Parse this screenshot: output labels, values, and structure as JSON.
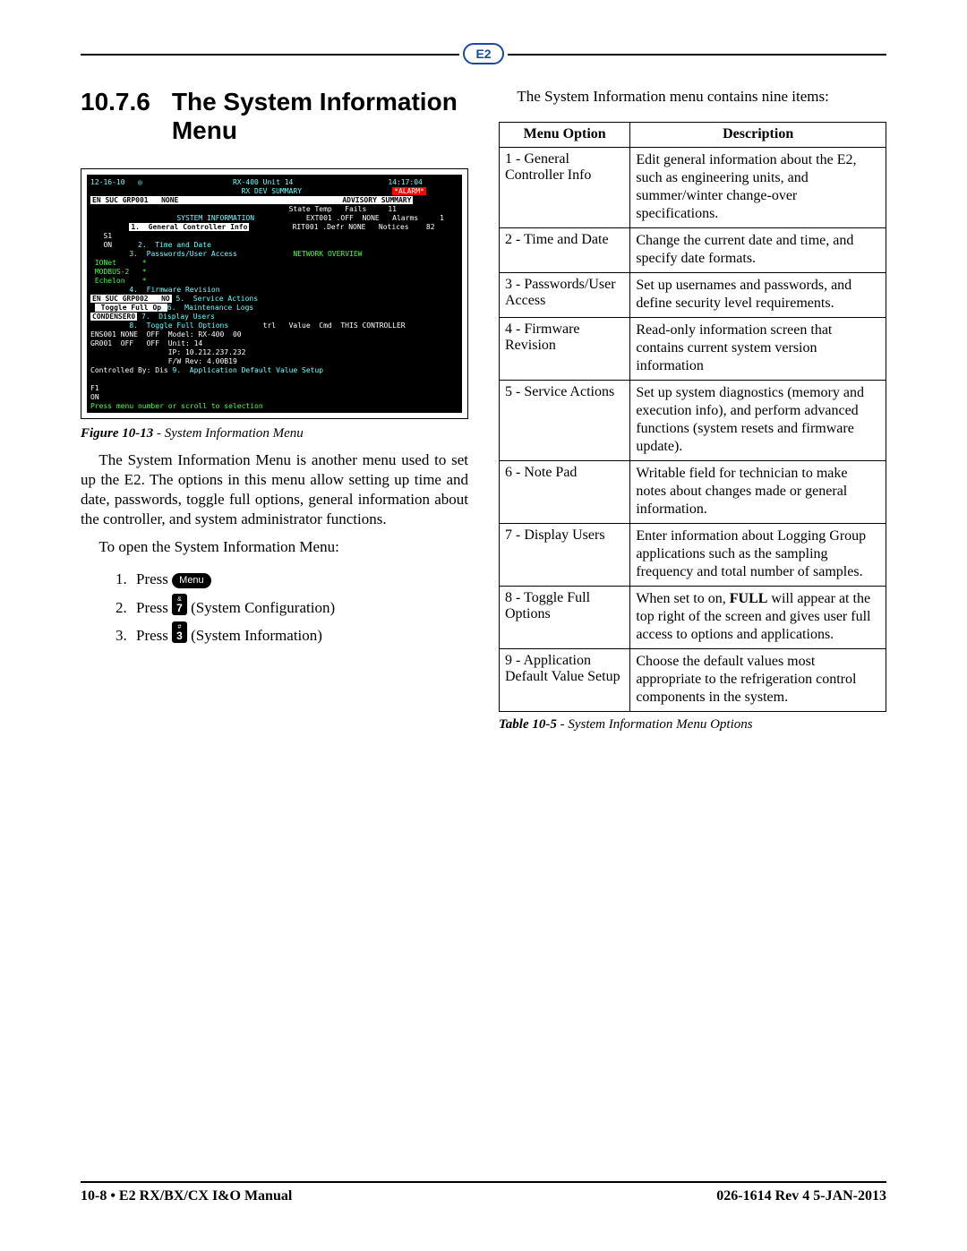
{
  "header_logo": "E2",
  "section": {
    "number": "10.7.6",
    "title": "The System Information Menu"
  },
  "figure": {
    "label": "Figure 10-13",
    "caption": "System Information Menu",
    "term": {
      "topline": "12-16-10   ◎                     RX-400 Unit 14                      14:17:04",
      "topline2": "                                   RX DEV SUMMARY                     ",
      "alarm": "*ALARM*",
      "row_head": "EN SUC GRP001   NONE                                      ADVISORY SUMMARY",
      "state": "State Temp   Fails     11",
      "menu_title": "          SYSTEM INFORMATION          ",
      "ext": "EXT001 .OFF  NONE   Alarms     1",
      "rit": "RIT001 .Defr NONE   Notices    82",
      "items": [
        "1.  General Controller Info",
        "2.  Time and Date",
        "3.  Passwords/User Access",
        "4.  Firmware Revision",
        "5.  Service Actions",
        "6.  Maintenance Logs",
        "7.  Display Users",
        "8.  Toggle Full Options",
        "9.  Application Default Value Setup"
      ],
      "s1": "   S1\n   ON",
      "nw": "NETWORK OVERVIEW\n IONet      *\n MODBUS-2   *\n Echelon    *",
      "ensuc2": "EN SUC GRP002   NO",
      "toggle": " Toggle Full Op ",
      "cond": "CONDENSER0",
      "ctrlby": "Controlled By: Dis",
      "f1": "F1\nON",
      "trl": "trl   Value  Cmd  THIS CONTROLLER\nENS001 NONE  OFF  Model: RX-400  00\nGR001  OFF   OFF  Unit: 14\n                  IP: 10.212.237.232\n                  F/W Rev: 4.00B19",
      "hint": "Press menu number or scroll to selection"
    }
  },
  "para": "The System Information Menu is another menu used to set up the E2. The options in this menu allow setting up time and date, passwords, toggle full options, general information about the controller, and system administrator functions.",
  "open_line": "To open the System Information Menu:",
  "steps": [
    {
      "pre": "Press ",
      "key_type": "menu",
      "key_label": "Menu",
      "post": ""
    },
    {
      "pre": "Press ",
      "key_type": "num",
      "key_top": "&",
      "key_btm": "7",
      "post": " (System Configuration)"
    },
    {
      "pre": "Press ",
      "key_type": "num",
      "key_top": "#",
      "key_btm": "3",
      "post": " (System Information)"
    }
  ],
  "right_intro": "The System Information menu contains nine items:",
  "table": {
    "headers": [
      "Menu Option",
      "Description"
    ],
    "rows": [
      {
        "opt": "1 - General Controller Info",
        "desc": "Edit general information about the E2, such as engineering units, and summer/winter change-over specifications."
      },
      {
        "opt": "2 - Time and Date",
        "desc": "Change the current date and time, and specify date formats."
      },
      {
        "opt": "3 - Passwords/User Access",
        "desc": "Set up usernames and passwords, and define security level requirements."
      },
      {
        "opt": "4 - Firmware Revision",
        "desc": "Read-only information screen that contains current system version information"
      },
      {
        "opt": "5 - Service Actions",
        "desc": "Set up system diagnostics (memory and execution info), and perform advanced functions (system resets and firmware update)."
      },
      {
        "opt": "6 - Note Pad",
        "desc": "Writable field for technician to make notes about changes made or general information."
      },
      {
        "opt": "7 - Display Users",
        "desc": "Enter information about Logging Group applications such as the sampling frequency and total number of samples."
      },
      {
        "opt": "8 - Toggle Full Options",
        "desc_html": "When set to on, <b>FULL</b> will appear at the top right of the screen and gives user full access to options and applications."
      },
      {
        "opt": "9 - Application Default Value Setup",
        "desc": "Choose the default values most appropriate to the refrigeration control components in the system."
      }
    ]
  },
  "table_caption": {
    "label": "Table 10-5",
    "text": "System Information Menu Options"
  },
  "footer": {
    "left": "10-8 • E2 RX/BX/CX I&O Manual",
    "right": "026-1614 Rev 4 5-JAN-2013"
  }
}
